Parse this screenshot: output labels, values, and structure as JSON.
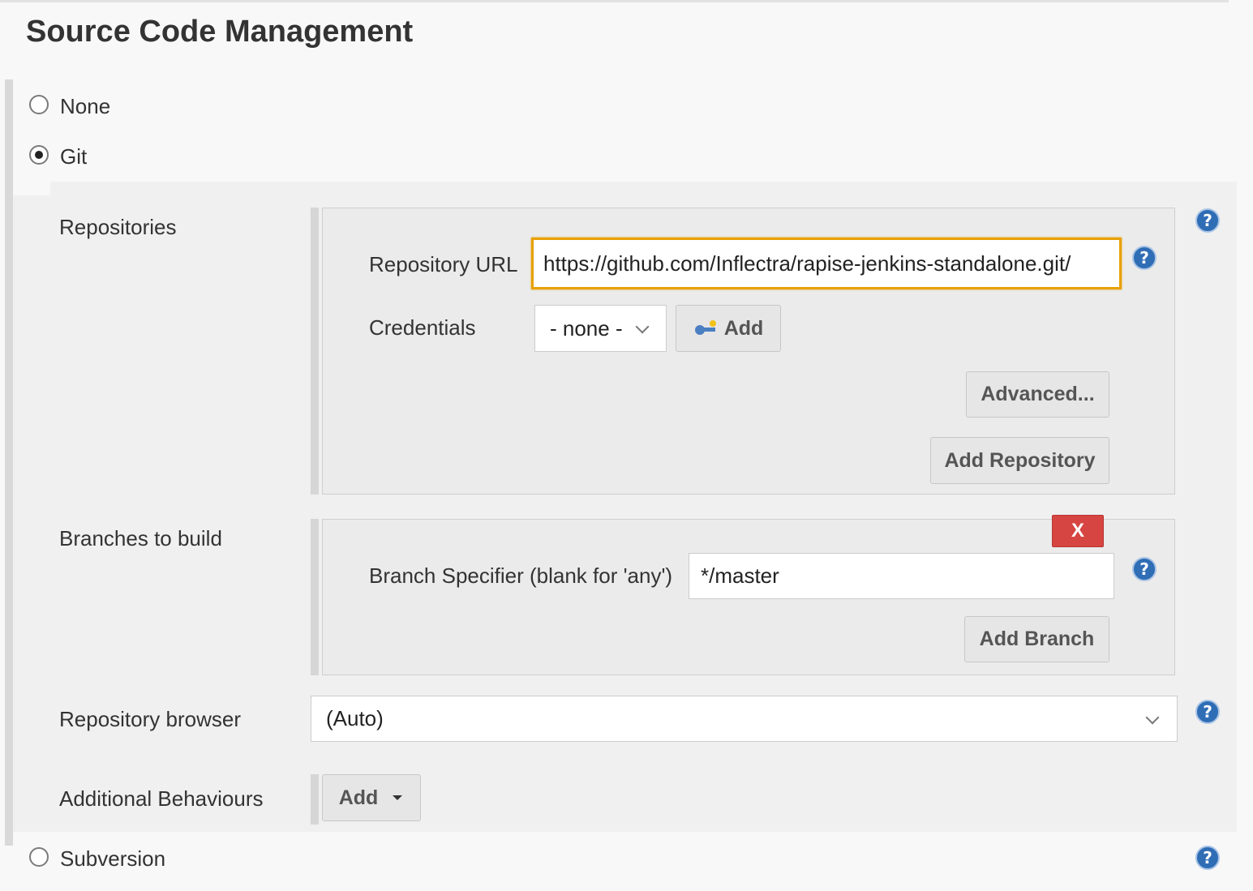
{
  "section": {
    "title": "Source Code Management"
  },
  "scm_options": {
    "none_label": "None",
    "git_label": "Git",
    "subversion_label": "Subversion",
    "selected": "Git"
  },
  "git": {
    "repositories_label": "Repositories",
    "repo_url_label": "Repository URL",
    "repo_url_value": "https://github.com/Inflectra/rapise-jenkins-standalone.git/",
    "credentials_label": "Credentials",
    "credentials_value": "- none -",
    "credentials_add_label": "Add",
    "advanced_label": "Advanced...",
    "add_repository_label": "Add Repository",
    "branches_label": "Branches to build",
    "delete_label": "X",
    "branch_specifier_label": "Branch Specifier (blank for 'any')",
    "branch_specifier_value": "*/master",
    "add_branch_label": "Add Branch",
    "repo_browser_label": "Repository browser",
    "repo_browser_value": "(Auto)",
    "additional_behaviours_label": "Additional Behaviours",
    "behaviours_add_label": "Add"
  },
  "help_glyph": "?",
  "icons": [
    "help-icon",
    "key-icon",
    "chevron-down-icon",
    "caret-down-icon"
  ],
  "colors": {
    "focus_border": "#e8a000",
    "help_blue": "#2f6db5",
    "delete_red": "#d64541"
  }
}
